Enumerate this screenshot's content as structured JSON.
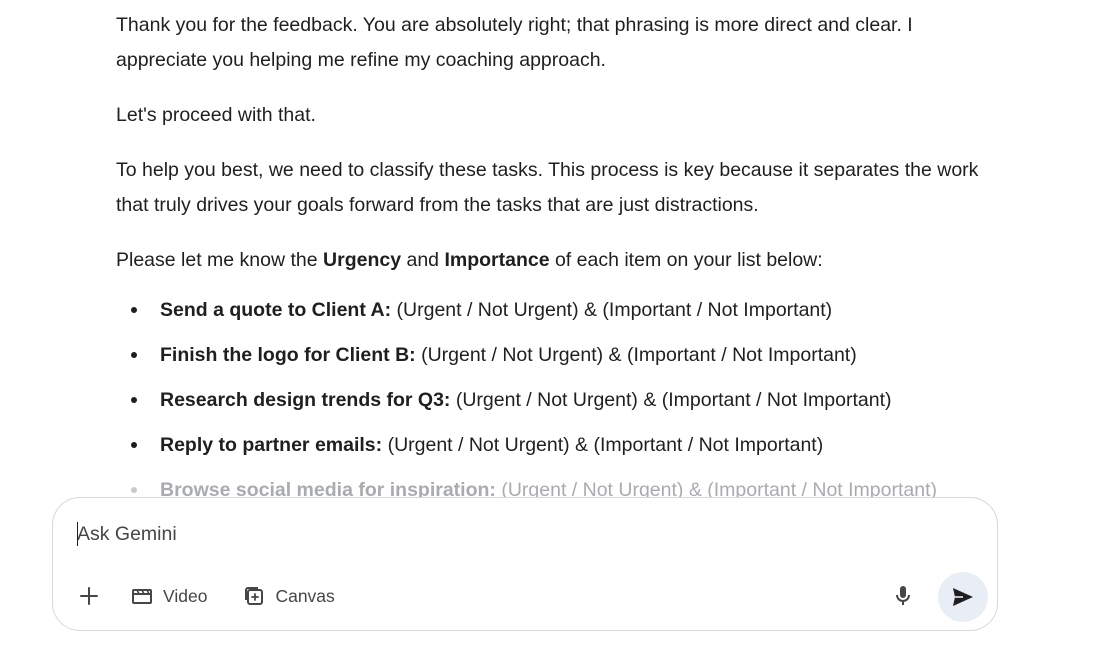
{
  "response": {
    "paragraphs": [
      "Thank you for the feedback. You are absolutely right; that phrasing is more direct and clear. I appreciate you helping me refine my coaching approach.",
      "Let's proceed with that.",
      "To help you best, we need to classify these tasks. This process is key because it separates the work that truly drives your goals forward from the tasks that are just distractions."
    ],
    "prompt_intro": {
      "before": "Please let me know the ",
      "urgency": "Urgency",
      "and": " and ",
      "importance": "Importance",
      "after": " of each item on your list below:"
    },
    "tasks": [
      {
        "name": "Send a quote to Client A:",
        "options": " (Urgent / Not Urgent) & (Important / Not Important)"
      },
      {
        "name": "Finish the logo for Client B:",
        "options": " (Urgent / Not Urgent) & (Important / Not Important)"
      },
      {
        "name": "Research design trends for Q3:",
        "options": " (Urgent / Not Urgent) & (Important / Not Important)"
      },
      {
        "name": "Reply to partner emails:",
        "options": " (Urgent / Not Urgent) & (Important / Not Important)"
      },
      {
        "name": "Browse social media for inspiration:",
        "options": " (Urgent / Not Urgent) & (Important / Not Important)"
      }
    ]
  },
  "composer": {
    "placeholder": "Ask Gemini",
    "value": "",
    "add_icon": "plus-icon",
    "video_label": "Video",
    "video_icon": "video-clapper-icon",
    "canvas_label": "Canvas",
    "canvas_icon": "canvas-icon",
    "mic_icon": "microphone-icon",
    "send_icon": "send-arrow-icon"
  },
  "colors": {
    "text": "#1f1f1f",
    "muted_text": "#444746",
    "faded_text": "#a8abb0",
    "composer_border": "#d5d8dd",
    "send_button_bg": "#e9eef6"
  }
}
